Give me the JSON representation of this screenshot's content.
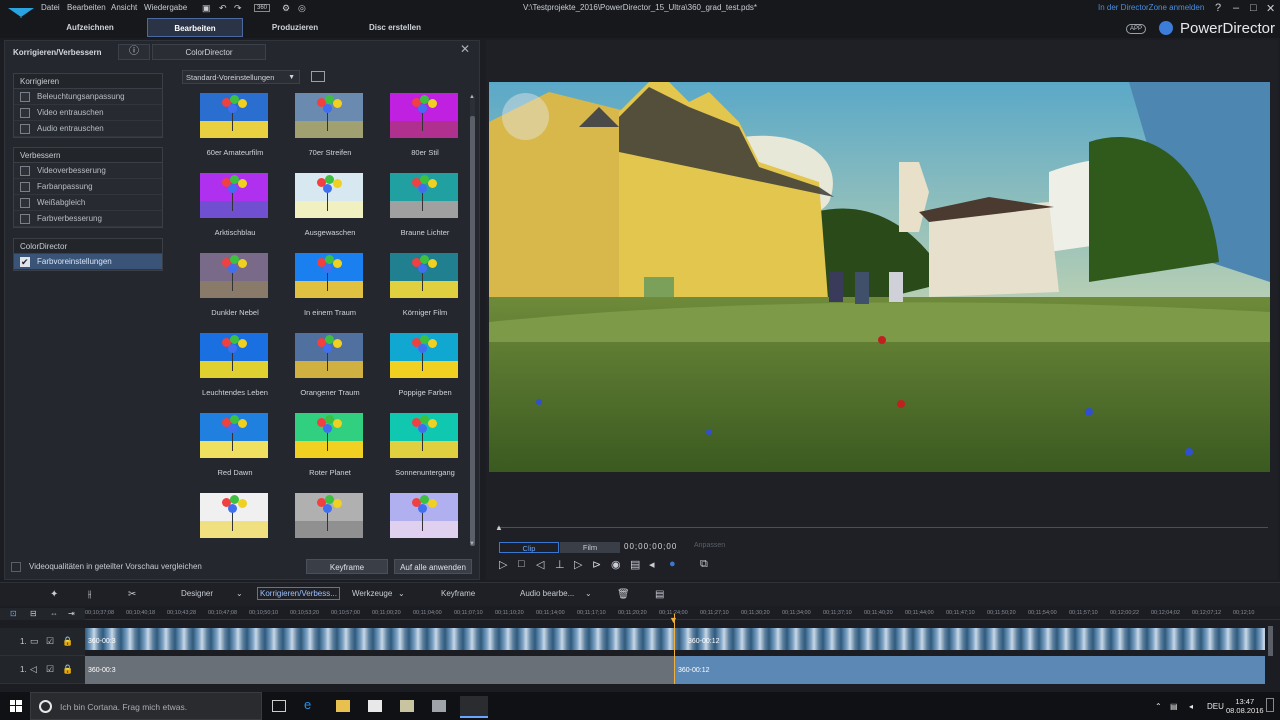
{
  "menubar": {
    "items": [
      "Datei",
      "Bearbeiten",
      "Ansicht",
      "Wiedergabe"
    ],
    "title": "V:\\Testprojekte_2016\\PowerDirector_15_Ultra\\360_grad_test.pds*",
    "zone_link": "In der DirectorZone anmelden",
    "undo_value": "360"
  },
  "tabs": [
    {
      "label": "Aufzeichnen"
    },
    {
      "label": "Bearbeiten"
    },
    {
      "label": "Produzieren"
    },
    {
      "label": "Disc erstellen"
    }
  ],
  "brand": {
    "app_badge": "APP",
    "name": "PowerDirector"
  },
  "left_panel": {
    "header": "Korrigieren/Verbessern",
    "colordirector_button": "ColorDirector",
    "sections": [
      {
        "title": "Korrigieren",
        "items": [
          "Beleuchtungsanpassung",
          "Video entrauschen",
          "Audio entrauschen"
        ]
      },
      {
        "title": "Verbessern",
        "items": [
          "Videoverbesserung",
          "Farbanpassung",
          "Weißabgleich",
          "Farbverbesserung"
        ]
      },
      {
        "title": "ColorDirector",
        "items": [
          "Farbvoreinstellungen"
        ]
      }
    ],
    "selected_item": "Farbvoreinstellungen",
    "preset_dropdown": "Standard-Voreinstellungen",
    "presets": [
      "60er Amateurfilm",
      "70er Streifen",
      "80er Stil",
      "Arktischblau",
      "Ausgewaschen",
      "Braune Lichter",
      "Dunkler Nebel",
      "In einem Traum",
      "Körniger Film",
      "Leuchtendes Leben",
      "Orangener Traum",
      "Poppige Farben",
      "Red Dawn",
      "Roter Planet",
      "Sonnenuntergang",
      "",
      "",
      ""
    ],
    "split_preview_label": "Videoqualitäten in geteilter Vorschau vergleichen",
    "keyframe_button": "Keyframe",
    "apply_all_button": "Auf alle anwenden"
  },
  "preview": {
    "clip_tab": "Clip",
    "film_tab": "Film",
    "timecode": "00;00;00;00",
    "anpassen": "Anpassen"
  },
  "timeline_toolbar": {
    "designer": "Designer",
    "korrigieren": "Korrigieren/Verbess...",
    "werkzeuge": "Werkzeuge",
    "keyframe": "Keyframe",
    "audio": "Audio bearbe..."
  },
  "ruler_ticks": [
    "00;10;37;08",
    "00;10;40;18",
    "00;10;43;28",
    "00;10;47;08",
    "00;10;50;10",
    "00;10;53;20",
    "00;10;57;00",
    "00;11;00;20",
    "00;11;04;00",
    "00;11;07;10",
    "00;11;10;20",
    "00;11;14;00",
    "00;11;17;10",
    "00;11;20;20",
    "00;11;24;00",
    "00;11;27;10",
    "00;11;30;20",
    "00;11;34;00",
    "00;11;37;10",
    "00;11;40;20",
    "00;11;44;00",
    "00;11;47;10",
    "00;11;50;20",
    "00;11;54;00",
    "00;11;57;10",
    "00;12;00;22",
    "00;12;04;02",
    "00;12;07;12",
    "00;12;10"
  ],
  "tracks": {
    "video_label": "1.",
    "audio_label": "1.",
    "clip1_video": "360-00:3",
    "clip2_video": "360-00:12",
    "clip1_audio": "360-00:3",
    "clip2_audio": "360-00:12"
  },
  "taskbar": {
    "cortana": "Ich bin Cortana. Frag mich etwas.",
    "lang": "DEU",
    "time": "13:47",
    "date": "08.08.2016"
  },
  "colors": {
    "accent": "#4a8fe0",
    "selected": "#3a5478",
    "track_audio": "#5b88b5"
  }
}
